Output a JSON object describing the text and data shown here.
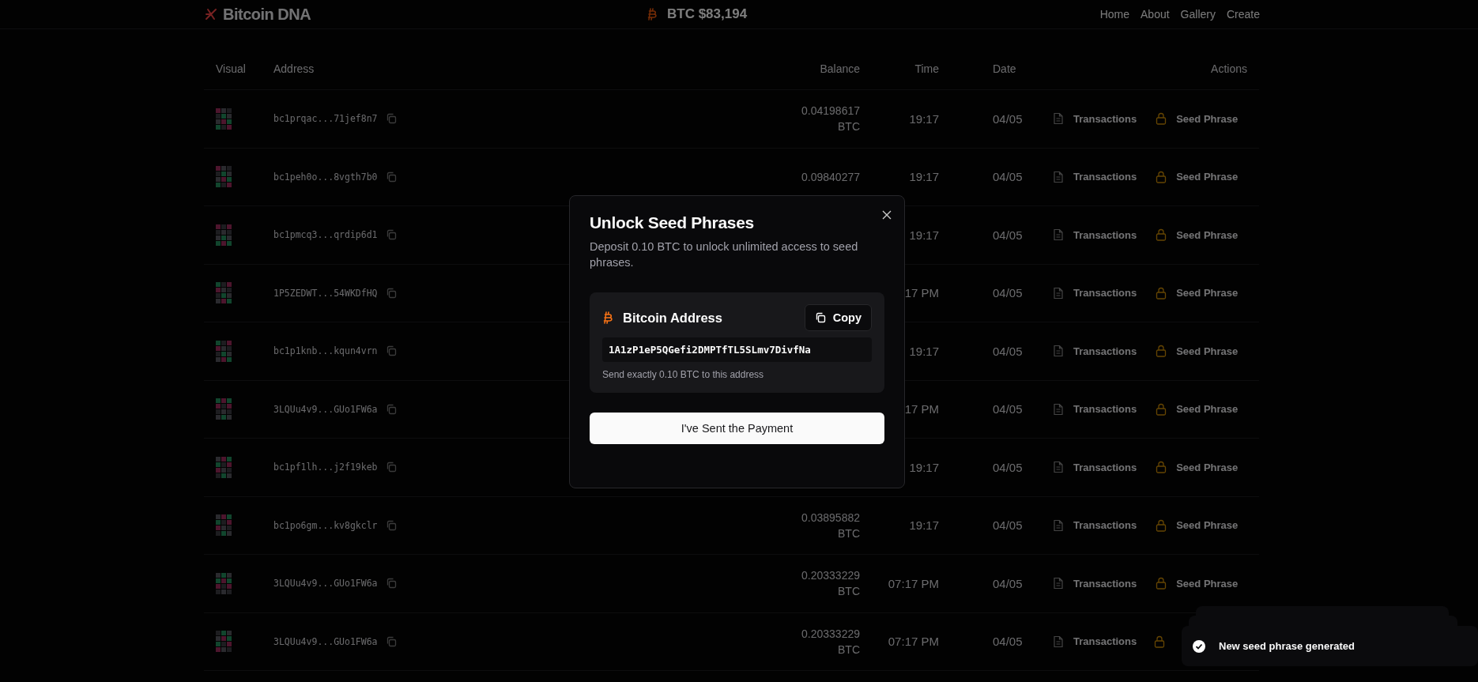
{
  "header": {
    "logo": "Bitcoin DNA",
    "price": "BTC $83,194",
    "nav": [
      {
        "label": "Home"
      },
      {
        "label": "About"
      },
      {
        "label": "Gallery"
      },
      {
        "label": "Create"
      }
    ]
  },
  "table": {
    "columns": [
      "Visual",
      "Address",
      "Balance",
      "Time",
      "Date",
      "Actions"
    ],
    "rows": [
      {
        "address": "bc1prqac...71jef8n7",
        "balance": "0.04198617 BTC",
        "time": "19:17",
        "date": "04/05",
        "transactions": "Transactions",
        "seed": "Seed Phrase"
      },
      {
        "address": "bc1peh0o...8vgth7b0",
        "balance": "0.09840277",
        "time": "19:17",
        "date": "04/05",
        "transactions": "Transactions",
        "seed": "Seed Phrase"
      },
      {
        "address": "bc1pmcq3...qrdip6d1",
        "time": "19:17",
        "date": "04/05",
        "transactions": "Transactions",
        "seed": "Seed Phrase"
      },
      {
        "address": "1P5ZEDWT...54WKDfHQ",
        "time": "17 PM",
        "date": "04/05",
        "transactions": "Transactions",
        "seed": "Seed Phrase"
      },
      {
        "address": "bc1p1knb...kqun4vrn",
        "time": "19:17",
        "date": "04/05",
        "transactions": "Transactions",
        "seed": "Seed Phrase"
      },
      {
        "address": "3LQUu4v9...GUo1FW6a",
        "time": "17 PM",
        "date": "04/05",
        "transactions": "Transactions",
        "seed": "Seed Phrase"
      },
      {
        "address": "bc1pf1lh...j2f19keb",
        "time": "19:17",
        "date": "04/05",
        "transactions": "Transactions",
        "seed": "Seed Phrase"
      },
      {
        "address": "bc1po6gm...kv8gkclr",
        "balance": "0.03895882 BTC",
        "time": "19:17",
        "date": "04/05",
        "transactions": "Transactions",
        "seed": "Seed Phrase"
      },
      {
        "address": "3LQUu4v9...GUo1FW6a",
        "balance": "0.20333229 BTC",
        "time": "07:17 PM",
        "date": "04/05",
        "transactions": "Transactions",
        "seed": "Seed Phrase"
      },
      {
        "address": "3LQUu4v9...GUo1FW6a",
        "balance": "0.20333229 BTC",
        "time": "07:17 PM",
        "date": "04/05",
        "transactions": "Transactions"
      }
    ]
  },
  "modal": {
    "title": "Unlock Seed Phrases",
    "description": "Deposit 0.10 BTC to unlock unlimited access to seed phrases.",
    "card_title": "Bitcoin Address",
    "copy": "Copy",
    "address": "1A1zP1eP5QGefi2DMPTfTL5SLmv7DivfNa",
    "note": "Send exactly 0.10 BTC to this address",
    "confirm": "I've Sent the Payment"
  },
  "toast": {
    "message": "New seed phrase generated"
  }
}
